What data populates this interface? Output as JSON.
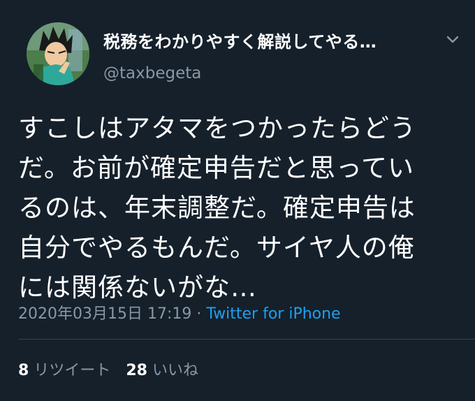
{
  "tweet": {
    "display_name": "税務をわかりやすく解説してやる…",
    "handle": "@taxbegeta",
    "body_lines": [
      "すこしはアタマをつかったらどう",
      "だ。お前が確定申告だと思ってい",
      "るのは、年末調整だ。確定申告は",
      "自分でやるもんだ。サイヤ人の俺",
      "には関係ないがな…"
    ],
    "timestamp": "2020年03月15日 17:19",
    "separator": " · ",
    "source": "Twitter for iPhone",
    "retweets_count": "8",
    "retweets_label": "リツイート",
    "likes_count": "28",
    "likes_label": "いいね"
  },
  "colors": {
    "background": "#15202b",
    "secondary_text": "#8899a6",
    "link": "#1da1f2",
    "divider": "#38444d"
  },
  "icons": {
    "avatar": "anime-character-avatar",
    "menu": "chevron-down-icon"
  }
}
